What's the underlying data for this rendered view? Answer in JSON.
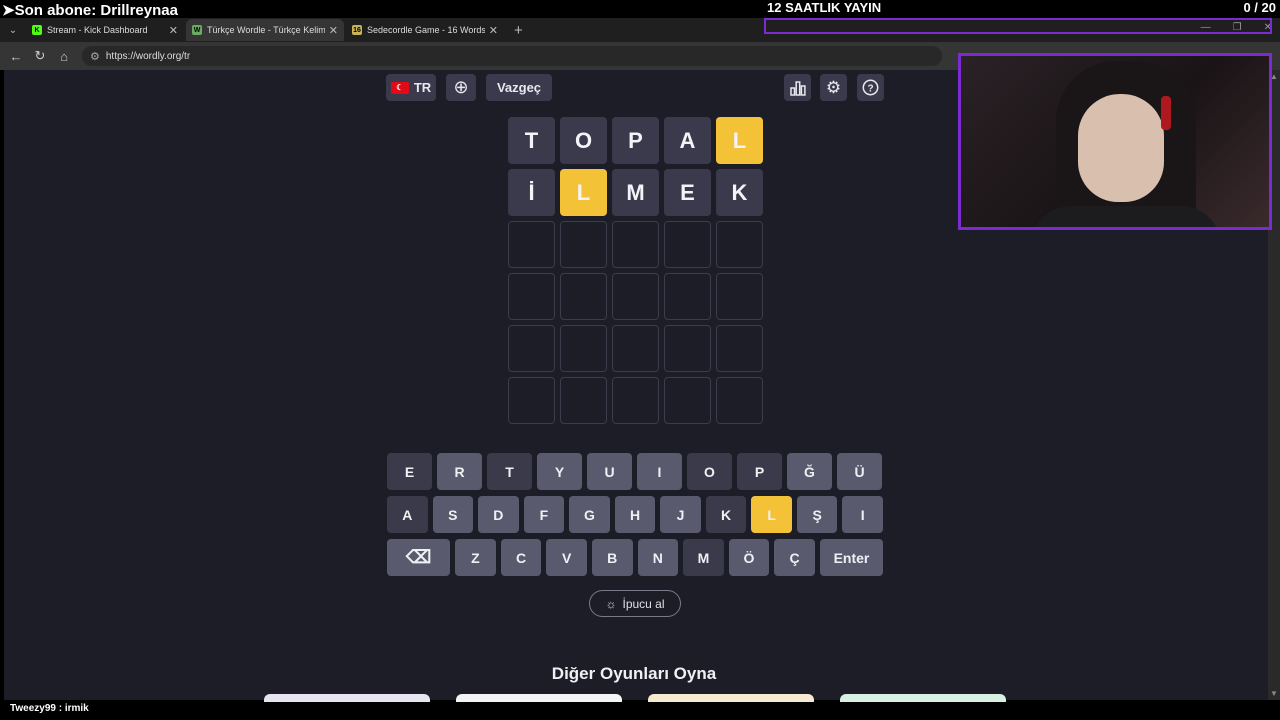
{
  "overlay": {
    "last_subscriber": "➤Son abone: Drillreynaa",
    "stream_label": "12 SAATLIK YAYIN",
    "goal_counter": "0  / 20",
    "chat_line": "Tweezy99 : irmik"
  },
  "browser": {
    "tabs": [
      {
        "label": "Stream - Kick Dashboard",
        "favicon": "K",
        "favicon_color": "#53fc18"
      },
      {
        "label": "Türkçe Wordle - Türkçe Kelimeler",
        "favicon": "W",
        "favicon_color": "#6aaa64"
      },
      {
        "label": "Sedecordle Game - 16 Words Wor",
        "favicon": "16",
        "favicon_color": "#c9b458"
      }
    ],
    "url": "https://wordly.org/tr"
  },
  "toolbar": {
    "language": "TR",
    "giveup": "Vazgeç"
  },
  "board": {
    "rows": [
      [
        {
          "l": "T",
          "s": "absent"
        },
        {
          "l": "O",
          "s": "absent"
        },
        {
          "l": "P",
          "s": "absent"
        },
        {
          "l": "A",
          "s": "absent"
        },
        {
          "l": "L",
          "s": "present"
        }
      ],
      [
        {
          "l": "İ",
          "s": "absent"
        },
        {
          "l": "L",
          "s": "present"
        },
        {
          "l": "M",
          "s": "absent"
        },
        {
          "l": "E",
          "s": "absent"
        },
        {
          "l": "K",
          "s": "absent"
        }
      ],
      [
        {
          "l": "",
          "s": "empty"
        },
        {
          "l": "",
          "s": "empty"
        },
        {
          "l": "",
          "s": "empty"
        },
        {
          "l": "",
          "s": "empty"
        },
        {
          "l": "",
          "s": "empty"
        }
      ],
      [
        {
          "l": "",
          "s": "empty"
        },
        {
          "l": "",
          "s": "empty"
        },
        {
          "l": "",
          "s": "empty"
        },
        {
          "l": "",
          "s": "empty"
        },
        {
          "l": "",
          "s": "empty"
        }
      ],
      [
        {
          "l": "",
          "s": "empty"
        },
        {
          "l": "",
          "s": "empty"
        },
        {
          "l": "",
          "s": "empty"
        },
        {
          "l": "",
          "s": "empty"
        },
        {
          "l": "",
          "s": "empty"
        }
      ],
      [
        {
          "l": "",
          "s": "empty"
        },
        {
          "l": "",
          "s": "empty"
        },
        {
          "l": "",
          "s": "empty"
        },
        {
          "l": "",
          "s": "empty"
        },
        {
          "l": "",
          "s": "empty"
        }
      ]
    ]
  },
  "keyboard": {
    "rows": [
      [
        {
          "k": "E",
          "s": "absent"
        },
        {
          "k": "R",
          "s": "unused"
        },
        {
          "k": "T",
          "s": "absent"
        },
        {
          "k": "Y",
          "s": "unused"
        },
        {
          "k": "U",
          "s": "unused"
        },
        {
          "k": "I",
          "s": "unused"
        },
        {
          "k": "O",
          "s": "absent"
        },
        {
          "k": "P",
          "s": "absent"
        },
        {
          "k": "Ğ",
          "s": "unused"
        },
        {
          "k": "Ü",
          "s": "unused"
        }
      ],
      [
        {
          "k": "A",
          "s": "absent"
        },
        {
          "k": "S",
          "s": "unused"
        },
        {
          "k": "D",
          "s": "unused"
        },
        {
          "k": "F",
          "s": "unused"
        },
        {
          "k": "G",
          "s": "unused"
        },
        {
          "k": "H",
          "s": "unused"
        },
        {
          "k": "J",
          "s": "unused"
        },
        {
          "k": "K",
          "s": "absent"
        },
        {
          "k": "L",
          "s": "present"
        },
        {
          "k": "Ş",
          "s": "unused"
        },
        {
          "k": "I",
          "s": "unused"
        }
      ],
      [
        {
          "k": "⌫",
          "s": "unused",
          "wide": true,
          "icon": "backspace-icon"
        },
        {
          "k": "Z",
          "s": "unused"
        },
        {
          "k": "C",
          "s": "unused"
        },
        {
          "k": "V",
          "s": "unused"
        },
        {
          "k": "B",
          "s": "unused"
        },
        {
          "k": "N",
          "s": "unused"
        },
        {
          "k": "M",
          "s": "absent"
        },
        {
          "k": "Ö",
          "s": "unused"
        },
        {
          "k": "Ç",
          "s": "unused"
        },
        {
          "k": "Enter",
          "s": "unused",
          "wide": true
        }
      ]
    ]
  },
  "hint_label": "İpucu al",
  "other_games_title": "Diğer Oyunları Oyna",
  "colors": {
    "present": "#f3c237",
    "absent": "#3a3a4c",
    "unused_key": "#5a5a6e",
    "page_bg": "#1d1d27",
    "stream_accent": "#7b2bd1"
  }
}
